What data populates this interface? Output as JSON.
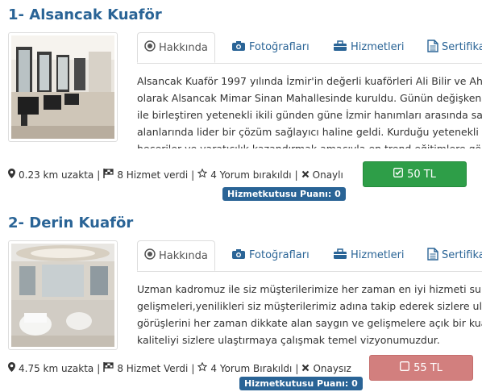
{
  "listings": [
    {
      "title": "1- Alsancak Kuaför",
      "tabs": [
        "Hakkında",
        "Fotoğrafları",
        "Hizmetleri",
        "Sertifikaları"
      ],
      "description_lines": [
        "Alsancak Kuaför 1997 yılında İzmir'in değerli kuaförleri Ali Bilir ve Ahmet",
        "olarak Alsancak Mimar Sinan Mahallesinde kuruldu. Günün değişken moda",
        "ile birleştiren yetenekli ikili günden güne İzmir hanımları arasında saç",
        "alanlarında lider bir çözüm sağlayıcı haline geldi. Kurduğu yetenekli ka",
        "beceriler ve yaratıcılık kazandırmak amacıyla en trend eğitimlere gön"
      ],
      "distance": "0.23 km uzakta",
      "services": "8 Hizmet verdi",
      "reviews": "4 Yorum bırakıldı",
      "approval": "Onaylı",
      "score_label": "Hizmetkutusu Puanı: 0",
      "price": "50 TL",
      "price_color": "#2e9e48"
    },
    {
      "title": "2- Derin Kuaför",
      "tabs": [
        "Hakkında",
        "Fotoğrafları",
        "Hizmetleri",
        "Sertifikaları"
      ],
      "description_lines": [
        "Uzman kadromuz ile siz müşterilerimize her zaman en iyi hizmeti sunmak",
        "gelişmeleri,yenilikleri siz müşterilerimiz adına takip ederek sizlere ulaştırma",
        "görüşlerini her zaman dikkate alan saygın ve gelişmelere açık bir kuaför",
        "kaliteliyi sizlere ulaştırmaya çalışmak temel vizyonumuzdur."
      ],
      "distance": "4.75 km uzakta",
      "services": "8 Hizmet Verdi",
      "reviews": "4 Yorum Bırakıldı",
      "approval": "Onaysız",
      "score_label": "Hizmetkutusu Puanı: 0",
      "price": "55 TL",
      "price_color": "#d27f7e"
    }
  ],
  "icons": {
    "about": "radio-circle-icon",
    "photos": "camera-icon",
    "services": "briefcase-icon",
    "certificates": "document-icon",
    "distance": "map-marker-icon",
    "services_count": "flag-icon",
    "reviews": "star-icon",
    "approval": "x-icon",
    "price_green": "check-square-icon",
    "price_red": "empty-square-icon"
  },
  "colors": {
    "title_blue": "#2a6496",
    "badge_blue": "#2a6496",
    "green_button": "#2e9e48",
    "red_button": "#d27f7e"
  }
}
